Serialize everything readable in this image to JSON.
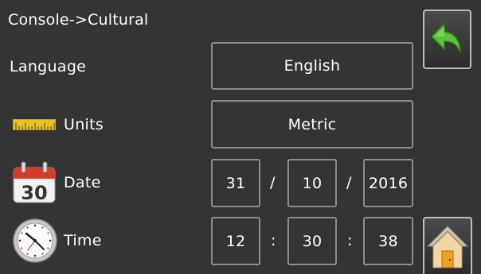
{
  "header": {
    "title": "Console->Cultural"
  },
  "rows": {
    "language": {
      "label": "Language",
      "value": "English"
    },
    "units": {
      "label": "Units",
      "value": "Metric",
      "icon": "ruler-icon"
    },
    "date": {
      "label": "Date",
      "day": "31",
      "month": "10",
      "year": "2016",
      "separator": "/",
      "icon": "calendar-icon",
      "icon_text": "30"
    },
    "time": {
      "label": "Time",
      "hour": "12",
      "minute": "30",
      "second": "38",
      "separator": ":",
      "icon": "clock-icon"
    }
  },
  "nav": {
    "back_icon": "back-arrow-icon",
    "home_icon": "home-icon"
  },
  "colors": {
    "background": "#343434",
    "field_border": "#8d8d8d",
    "back_arrow": "#5cc23a",
    "ruler": "#e8c021",
    "calendar_red": "#d63a2a"
  }
}
